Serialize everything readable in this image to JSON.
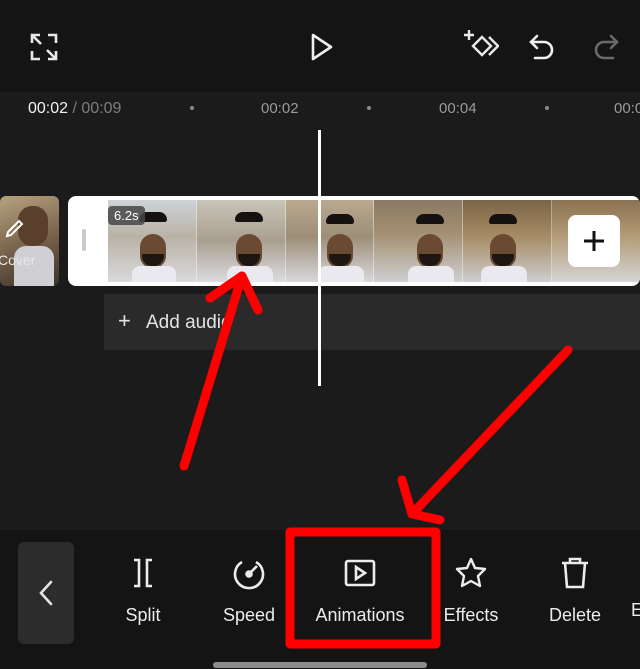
{
  "timeline": {
    "current": "00:02",
    "separator": " / ",
    "total": "00:09",
    "ticks": [
      "00:02",
      "00:04",
      "00:0"
    ]
  },
  "cover": {
    "label": "Cover"
  },
  "clip": {
    "duration": "6.2s"
  },
  "audio": {
    "plus": "+",
    "label": "Add audio"
  },
  "tools": [
    {
      "label": "Split",
      "icon": "split-icon"
    },
    {
      "label": "Speed",
      "icon": "speed-icon"
    },
    {
      "label": "Animations",
      "icon": "animations-icon"
    },
    {
      "label": "Effects",
      "icon": "effects-icon"
    },
    {
      "label": "Delete",
      "icon": "delete-icon"
    },
    {
      "label": "E",
      "icon": ""
    }
  ],
  "colors": {
    "background": "#141414",
    "panel": "#1b1b1b",
    "annotation": "#ff0000"
  }
}
